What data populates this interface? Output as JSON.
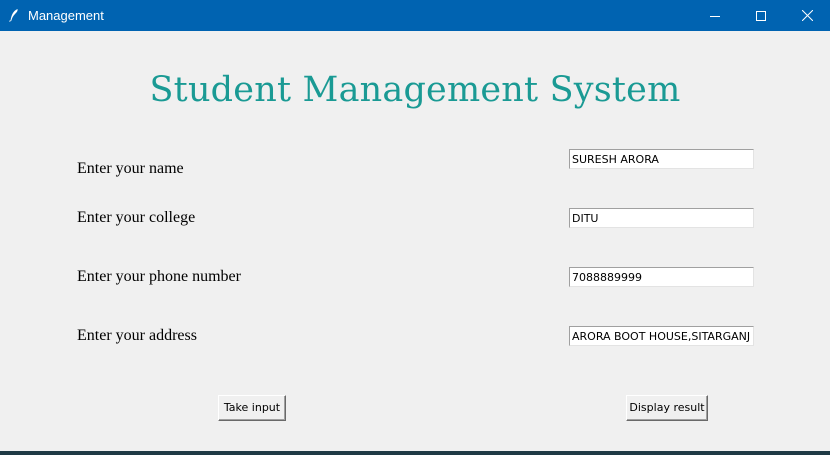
{
  "window": {
    "title": "Management",
    "titlebar_color": "#0063b1",
    "controls": {
      "minimize": "minimize-icon",
      "maximize": "maximize-icon",
      "close": "close-icon"
    }
  },
  "heading": {
    "text": "Student Management System",
    "color": "#1a9a94"
  },
  "form": {
    "name": {
      "label": "Enter your name",
      "value": "SURESH ARORA"
    },
    "college": {
      "label": "Enter your college",
      "value": "DITU"
    },
    "phone": {
      "label": "Enter your phone number",
      "value": "7088889999"
    },
    "address": {
      "label": "Enter your address",
      "value": "ARORA BOOT HOUSE,SITARGANJ"
    }
  },
  "buttons": {
    "take_input": "Take input",
    "display_result": "Display result"
  }
}
